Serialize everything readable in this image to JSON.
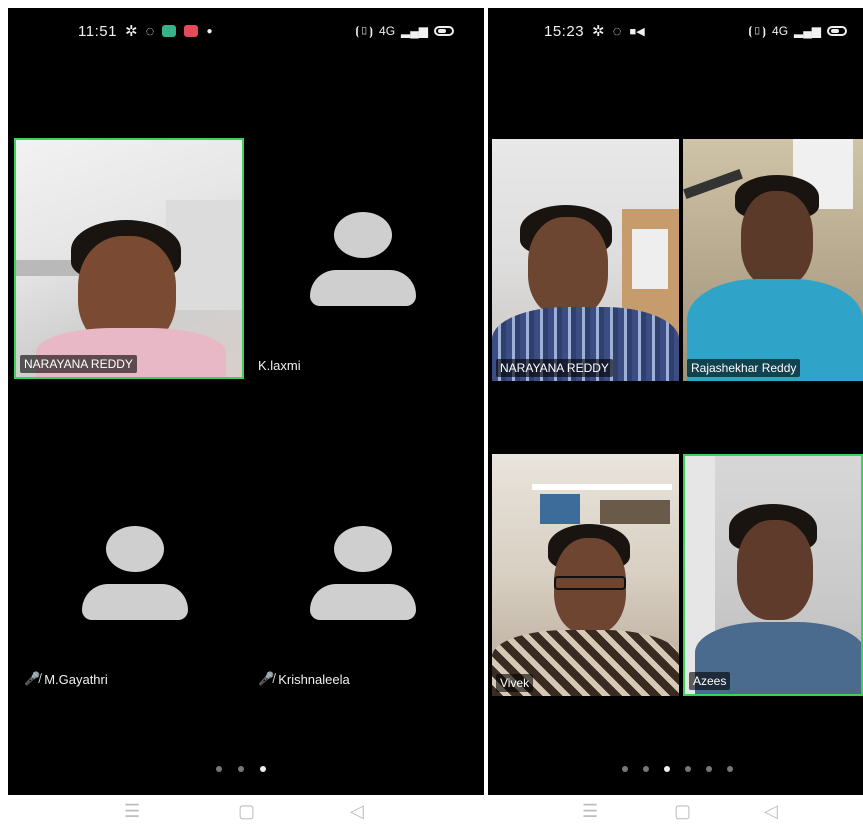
{
  "left_phone": {
    "status": {
      "time": "11:51",
      "network": "4G"
    },
    "participants": [
      {
        "name": "NARAYANA REDDY",
        "video": true,
        "active": true
      },
      {
        "name": "K.laxmi",
        "video": false
      },
      {
        "name": "M.Gayathri",
        "video": false,
        "muted": true
      },
      {
        "name": "Krishnaleela",
        "video": false,
        "muted": true
      }
    ],
    "page_dots": 3,
    "current_dot": 3
  },
  "right_phone": {
    "status": {
      "time": "15:23",
      "network": "4G"
    },
    "participants": [
      {
        "name": "NARAYANA REDDY",
        "video": true
      },
      {
        "name": "Rajashekhar Reddy",
        "video": true
      },
      {
        "name": "Vivek",
        "video": true
      },
      {
        "name": "Azees",
        "video": true,
        "active": true
      }
    ],
    "page_dots": 6,
    "current_dot": 3
  },
  "navbar": {
    "menu": "☰",
    "home": "▢",
    "back": "◁"
  },
  "colors": {
    "active_border": "#3ecf5d",
    "screen_bg": "#000000",
    "avatar": "#cfcfcf"
  }
}
